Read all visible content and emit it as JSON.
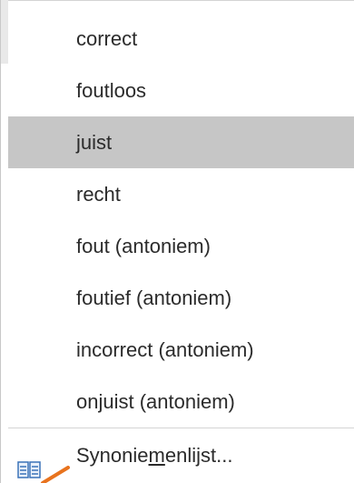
{
  "menu": {
    "items": [
      {
        "label": "correct"
      },
      {
        "label": "foutloos"
      },
      {
        "label": "juist"
      },
      {
        "label": "recht"
      },
      {
        "label": "fout (antoniem)"
      },
      {
        "label": "foutief (antoniem)"
      },
      {
        "label": "incorrect (antoniem)"
      },
      {
        "label": "onjuist (antoniem)"
      }
    ],
    "selected_label": "juist",
    "footer": {
      "label_before": "Synonie",
      "label_underlined": "m",
      "label_after": "enlijst...",
      "icon": "thesaurus-icon"
    }
  },
  "colors": {
    "selected_background": "#c6c6c6",
    "text": "#2b2b2b",
    "arrow": "#e8731e",
    "icon": "#3a72b8"
  }
}
